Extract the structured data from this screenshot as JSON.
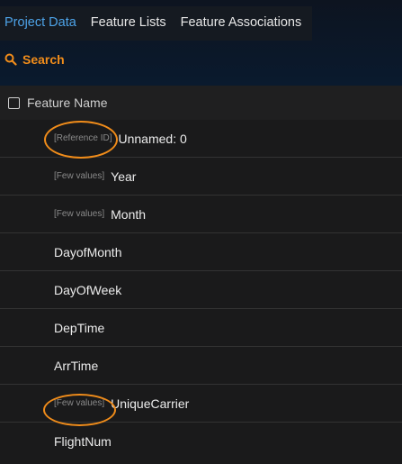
{
  "tabs": [
    {
      "label": "Project Data",
      "active": true
    },
    {
      "label": "Feature Lists",
      "active": false
    },
    {
      "label": "Feature Associations",
      "active": false
    }
  ],
  "search": {
    "label": "Search",
    "icon": "search-icon",
    "color": "#f08c1a"
  },
  "table": {
    "header": "Feature Name",
    "rows": [
      {
        "tag": "[Reference ID]",
        "name": "Unnamed: 0"
      },
      {
        "tag": "[Few values]",
        "name": "Year"
      },
      {
        "tag": "[Few values]",
        "name": "Month"
      },
      {
        "tag": "",
        "name": "DayofMonth"
      },
      {
        "tag": "",
        "name": "DayOfWeek"
      },
      {
        "tag": "",
        "name": "DepTime"
      },
      {
        "tag": "",
        "name": "ArrTime"
      },
      {
        "tag": "[Few values]",
        "name": "UniqueCarrier"
      },
      {
        "tag": "",
        "name": "FlightNum"
      }
    ]
  },
  "colors": {
    "accent_orange": "#f08c1a",
    "active_tab_blue": "#4da3e8"
  }
}
